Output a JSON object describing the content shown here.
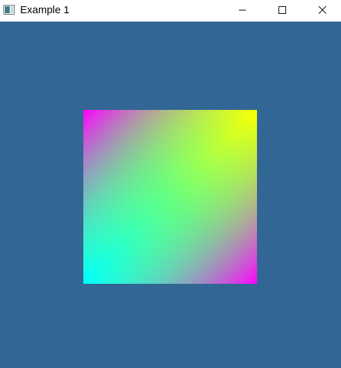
{
  "window": {
    "title": "Example 1",
    "icon": "app-window-icon",
    "controls": {
      "minimize_icon": "minimize-icon",
      "maximize_icon": "maximize-icon",
      "close_icon": "close-icon"
    }
  },
  "viewport": {
    "background_color": "#326694"
  },
  "gradient_square": {
    "corner_colors": {
      "top_left": "#ff00ff",
      "top_right": "#ffff00",
      "bottom_left": "#00ffff",
      "bottom_right": "#ff00ff",
      "center": "#66ff80"
    }
  }
}
